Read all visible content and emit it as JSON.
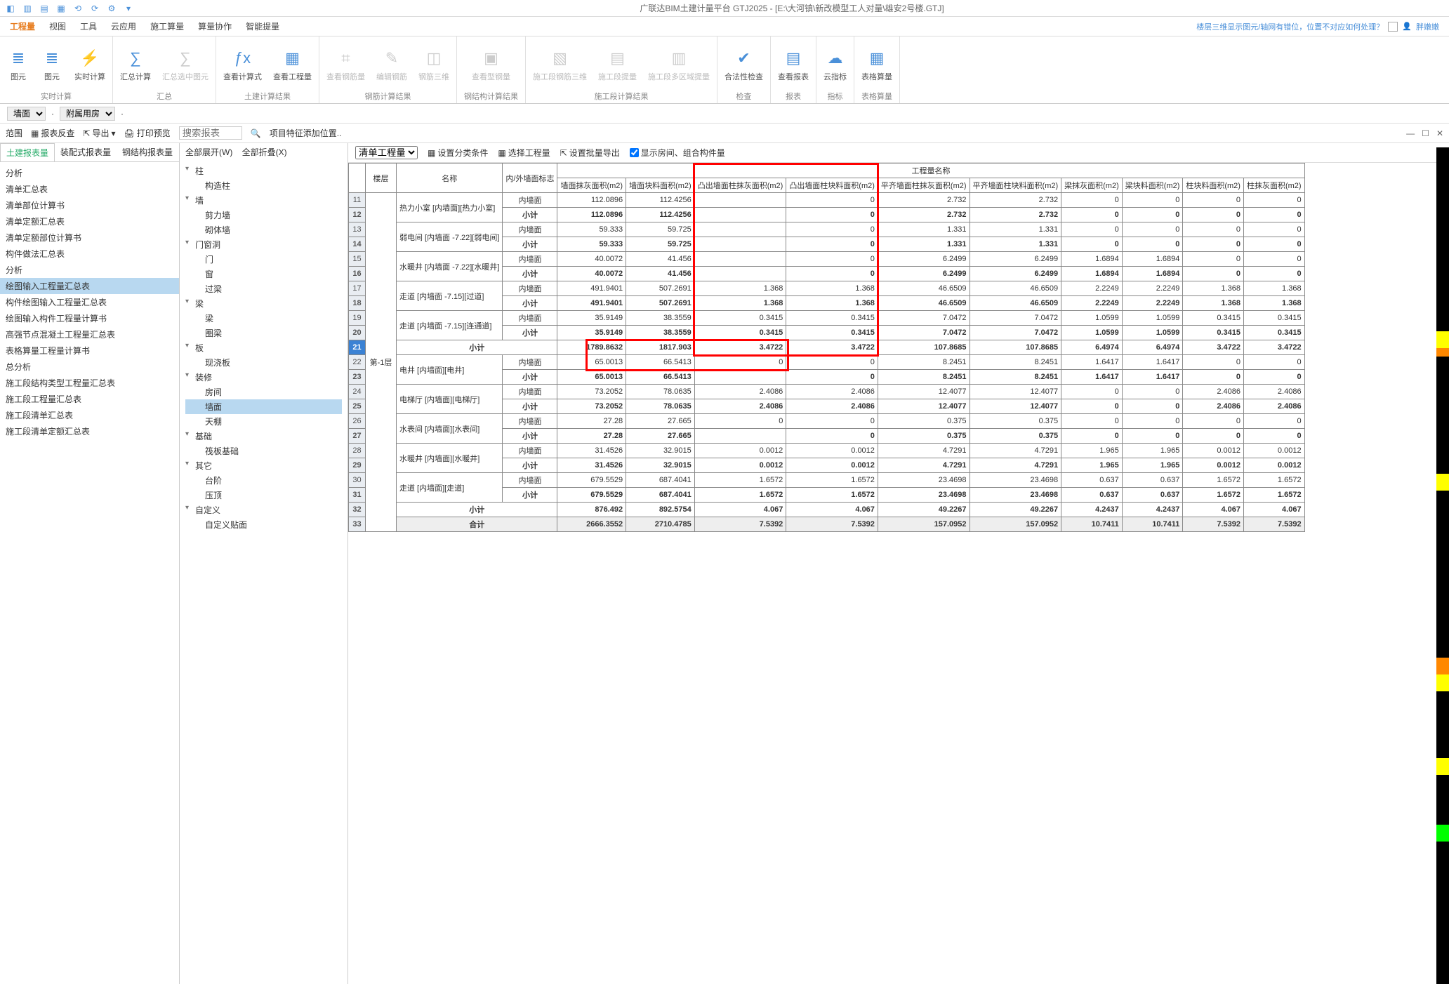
{
  "app_title": "广联达BIM土建计量平台 GTJ2025 - [E:\\大河镇\\新改模型工人对量\\雄安2号楼.GTJ]",
  "menu": {
    "tabs": [
      "工程量",
      "视图",
      "工具",
      "云应用",
      "施工算量",
      "算量协作",
      "智能提量"
    ],
    "active": 0,
    "right_text": "楼层三维显示图元/轴网有错位，位置不对应如何处理？",
    "user": "胖嫩嫩"
  },
  "ribbon": [
    {
      "name": "实时计算",
      "items": [
        {
          "icon": "lines",
          "label": "图元"
        },
        {
          "icon": "lines",
          "label": "图元"
        },
        {
          "icon": "calc",
          "label": "实时计算"
        }
      ]
    },
    {
      "name": "汇总",
      "items": [
        {
          "icon": "sigma",
          "label": "汇总计算"
        },
        {
          "icon": "sigma-d",
          "label": "汇总选中图元",
          "disabled": true
        }
      ]
    },
    {
      "name": "土建计算结果",
      "items": [
        {
          "icon": "fx",
          "label": "查看计算式"
        },
        {
          "icon": "grid",
          "label": "查看工程量"
        }
      ]
    },
    {
      "name": "钢筋计算结果",
      "items": [
        {
          "icon": "rebar",
          "label": "查看钢筋量",
          "disabled": true
        },
        {
          "icon": "edit",
          "label": "编辑钢筋",
          "disabled": true
        },
        {
          "icon": "3d",
          "label": "钢筋三维",
          "disabled": true
        }
      ]
    },
    {
      "name": "钢结构计算结果",
      "items": [
        {
          "icon": "steel",
          "label": "查看型钢量",
          "disabled": true
        }
      ]
    },
    {
      "name": "施工段计算结果",
      "items": [
        {
          "icon": "s3d",
          "label": "施工段钢筋三维",
          "disabled": true
        },
        {
          "icon": "slift",
          "label": "施工段提量",
          "disabled": true
        },
        {
          "icon": "sarea",
          "label": "施工段多区域提量",
          "disabled": true
        }
      ]
    },
    {
      "name": "检查",
      "items": [
        {
          "icon": "check",
          "label": "合法性检查"
        }
      ]
    },
    {
      "name": "报表",
      "items": [
        {
          "icon": "report",
          "label": "查看报表"
        }
      ]
    },
    {
      "name": "指标",
      "items": [
        {
          "icon": "cloud",
          "label": "云指标"
        }
      ]
    },
    {
      "name": "表格算量",
      "items": [
        {
          "icon": "table",
          "label": "表格算量"
        }
      ]
    }
  ],
  "subbar": {
    "sel1": "墙面",
    "sel2": "附属用房"
  },
  "panel_row": {
    "btns": [
      "范围",
      "报表反查",
      "导出",
      "打印预览"
    ],
    "search_ph": "搜索报表",
    "extra": "项目特征添加位置.."
  },
  "left_tabs": [
    "土建报表量",
    "装配式报表量",
    "钢结构报表量"
  ],
  "left_active": 0,
  "left_list": [
    "分析",
    "清单汇总表",
    "清单部位计算书",
    "清单定额汇总表",
    "清单定额部位计算书",
    "构件做法汇总表",
    "分析",
    "绘图输入工程量汇总表",
    "构件绘图输入工程量汇总表",
    "绘图输入构件工程量计算书",
    "高强节点混凝土工程量汇总表",
    "表格算量工程量计算书",
    "总分析",
    "施工段结构类型工程量汇总表",
    "施工段工程量汇总表",
    "施工段清单汇总表",
    "施工段清单定额汇总表"
  ],
  "left_selected": 7,
  "mid_top": {
    "expand": "全部展开(W)",
    "collapse": "全部折叠(X)"
  },
  "tree": [
    {
      "label": "柱",
      "children": [
        "构造柱"
      ]
    },
    {
      "label": "墙",
      "children": [
        "剪力墙",
        "砌体墙"
      ]
    },
    {
      "label": "门窗洞",
      "children": [
        "门",
        "窗",
        "过梁"
      ]
    },
    {
      "label": "梁",
      "children": [
        "梁",
        "圈梁"
      ]
    },
    {
      "label": "板",
      "children": [
        "现浇板"
      ]
    },
    {
      "label": "装修",
      "children": [
        "房间",
        "墙面",
        "天棚"
      ]
    },
    {
      "label": "基础",
      "children": [
        "筏板基础"
      ]
    },
    {
      "label": "其它",
      "children": [
        "台阶",
        "压顶"
      ]
    },
    {
      "label": "自定义",
      "children": [
        "自定义贴面"
      ]
    }
  ],
  "tree_selected": "墙面",
  "right_tools": {
    "sel": "清单工程量",
    "btns": [
      "设置分类条件",
      "选择工程量",
      "设置批量导出"
    ],
    "chk": "显示房间、组合构件量"
  },
  "table": {
    "super_header": "工程量名称",
    "headers": [
      "楼层",
      "名称",
      "内/外墙面标志",
      "墙面抹灰面积(m2)",
      "墙面块料面积(m2)",
      "凸出墙面柱抹灰面积(m2)",
      "凸出墙面柱块料面积(m2)",
      "平齐墙面柱抹灰面积(m2)",
      "平齐墙面柱块料面积(m2)",
      "梁抹灰面积(m2)",
      "梁块料面积(m2)",
      "柱块料面积(m2)",
      "柱抹灰面积(m2)"
    ],
    "floor_label": "第-1层",
    "row_start": 11,
    "rows": [
      {
        "name": "热力小室 [内墙面][热力小室]",
        "mark": "内墙面",
        "v": [
          "112.0896",
          "112.4256",
          "",
          "0",
          "2.732",
          "2.732",
          "0",
          "0",
          "0",
          "0"
        ]
      },
      {
        "subtotal": true,
        "label": "小计",
        "v": [
          "112.0896",
          "112.4256",
          "",
          "0",
          "2.732",
          "2.732",
          "0",
          "0",
          "0",
          "0"
        ]
      },
      {
        "name": "弱电间 [内墙面 -7.22][弱电间]",
        "mark": "内墙面",
        "v": [
          "59.333",
          "59.725",
          "",
          "0",
          "1.331",
          "1.331",
          "0",
          "0",
          "0",
          "0"
        ]
      },
      {
        "subtotal": true,
        "label": "小计",
        "v": [
          "59.333",
          "59.725",
          "",
          "0",
          "1.331",
          "1.331",
          "0",
          "0",
          "0",
          "0"
        ]
      },
      {
        "name": "水暖井 [内墙面 -7.22][水暖井]",
        "mark": "内墙面",
        "v": [
          "40.0072",
          "41.456",
          "",
          "0",
          "6.2499",
          "6.2499",
          "1.6894",
          "1.6894",
          "0",
          "0"
        ]
      },
      {
        "subtotal": true,
        "label": "小计",
        "v": [
          "40.0072",
          "41.456",
          "",
          "0",
          "6.2499",
          "6.2499",
          "1.6894",
          "1.6894",
          "0",
          "0"
        ]
      },
      {
        "name": "走道 [内墙面 -7.15][过道]",
        "mark": "内墙面",
        "v": [
          "491.9401",
          "507.2691",
          "1.368",
          "1.368",
          "46.6509",
          "46.6509",
          "2.2249",
          "2.2249",
          "1.368",
          "1.368"
        ]
      },
      {
        "subtotal": true,
        "label": "小计",
        "v": [
          "491.9401",
          "507.2691",
          "1.368",
          "1.368",
          "46.6509",
          "46.6509",
          "2.2249",
          "2.2249",
          "1.368",
          "1.368"
        ]
      },
      {
        "name": "走道 [内墙面 -7.15][连通道]",
        "mark": "内墙面",
        "v": [
          "35.9149",
          "38.3559",
          "0.3415",
          "0.3415",
          "7.0472",
          "7.0472",
          "1.0599",
          "1.0599",
          "0.3415",
          "0.3415"
        ]
      },
      {
        "subtotal": true,
        "label": "小计",
        "v": [
          "35.9149",
          "38.3559",
          "0.3415",
          "0.3415",
          "7.0472",
          "7.0472",
          "1.0599",
          "1.0599",
          "0.3415",
          "0.3415"
        ]
      },
      {
        "grand": true,
        "label": "小计",
        "v": [
          "1789.8632",
          "1817.903",
          "3.4722",
          "3.4722",
          "107.8685",
          "107.8685",
          "6.4974",
          "6.4974",
          "3.4722",
          "3.4722"
        ]
      },
      {
        "name": "电井 [内墙面][电井]",
        "mark": "内墙面",
        "v": [
          "65.0013",
          "66.5413",
          "0",
          "0",
          "8.2451",
          "8.2451",
          "1.6417",
          "1.6417",
          "0",
          "0"
        ]
      },
      {
        "subtotal": true,
        "label": "小计",
        "v": [
          "65.0013",
          "66.5413",
          "",
          "0",
          "8.2451",
          "8.2451",
          "1.6417",
          "1.6417",
          "0",
          "0"
        ]
      },
      {
        "name": "电梯厅 [内墙面][电梯厅]",
        "mark": "内墙面",
        "v": [
          "73.2052",
          "78.0635",
          "2.4086",
          "2.4086",
          "12.4077",
          "12.4077",
          "0",
          "0",
          "2.4086",
          "2.4086"
        ]
      },
      {
        "subtotal": true,
        "label": "小计",
        "v": [
          "73.2052",
          "78.0635",
          "2.4086",
          "2.4086",
          "12.4077",
          "12.4077",
          "0",
          "0",
          "2.4086",
          "2.4086"
        ]
      },
      {
        "name": "水表间 [内墙面][水表间]",
        "mark": "内墙面",
        "v": [
          "27.28",
          "27.665",
          "0",
          "0",
          "0.375",
          "0.375",
          "0",
          "0",
          "0",
          "0"
        ]
      },
      {
        "subtotal": true,
        "label": "小计",
        "v": [
          "27.28",
          "27.665",
          "",
          "0",
          "0.375",
          "0.375",
          "0",
          "0",
          "0",
          "0"
        ]
      },
      {
        "name": "水暖井 [内墙面][水暖井]",
        "mark": "内墙面",
        "v": [
          "31.4526",
          "32.9015",
          "0.0012",
          "0.0012",
          "4.7291",
          "4.7291",
          "1.965",
          "1.965",
          "0.0012",
          "0.0012"
        ]
      },
      {
        "subtotal": true,
        "label": "小计",
        "v": [
          "31.4526",
          "32.9015",
          "0.0012",
          "0.0012",
          "4.7291",
          "4.7291",
          "1.965",
          "1.965",
          "0.0012",
          "0.0012"
        ]
      },
      {
        "name": "走道 [内墙面][走道]",
        "mark": "内墙面",
        "v": [
          "679.5529",
          "687.4041",
          "1.6572",
          "1.6572",
          "23.4698",
          "23.4698",
          "0.637",
          "0.637",
          "1.6572",
          "1.6572"
        ]
      },
      {
        "subtotal": true,
        "label": "小计",
        "v": [
          "679.5529",
          "687.4041",
          "1.6572",
          "1.6572",
          "23.4698",
          "23.4698",
          "0.637",
          "0.637",
          "1.6572",
          "1.6572"
        ]
      },
      {
        "grandc": true,
        "label": "小计",
        "v": [
          "876.492",
          "892.5754",
          "4.067",
          "4.067",
          "49.2267",
          "49.2267",
          "4.2437",
          "4.2437",
          "4.067",
          "4.067"
        ]
      },
      {
        "total": true,
        "label": "合计",
        "v": [
          "2666.3552",
          "2710.4785",
          "7.5392",
          "7.5392",
          "157.0952",
          "157.0952",
          "10.7411",
          "10.7411",
          "7.5392",
          "7.5392"
        ]
      }
    ]
  }
}
